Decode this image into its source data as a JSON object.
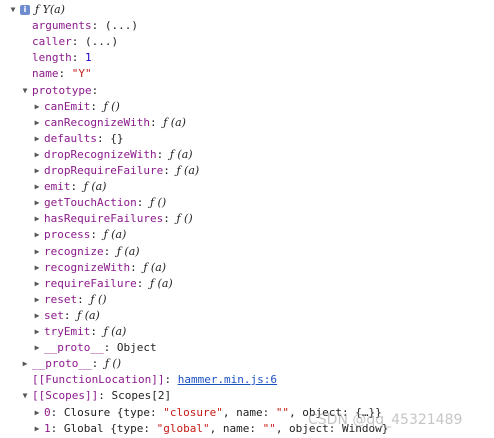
{
  "rows": [
    {
      "depth": 0,
      "arrow": "down",
      "badge": "i",
      "key": "",
      "sep": "",
      "value": "ƒ Y(a)",
      "vtype": "fn"
    },
    {
      "depth": 1,
      "arrow": "none",
      "key": "arguments",
      "sep": ": ",
      "value": "(...)",
      "vtype": "obj"
    },
    {
      "depth": 1,
      "arrow": "none",
      "key": "caller",
      "sep": ": ",
      "value": "(...)",
      "vtype": "obj"
    },
    {
      "depth": 1,
      "arrow": "none",
      "key": "length",
      "sep": ": ",
      "value": "1",
      "vtype": "num"
    },
    {
      "depth": 1,
      "arrow": "none",
      "key": "name",
      "sep": ": ",
      "value": "\"Y\"",
      "vtype": "str"
    },
    {
      "depth": 1,
      "arrow": "down",
      "key": "prototype",
      "sep": ":",
      "value": "",
      "vtype": "obj"
    },
    {
      "depth": 2,
      "arrow": "right",
      "key": "canEmit",
      "sep": ": ",
      "value": "ƒ ()",
      "vtype": "fn"
    },
    {
      "depth": 2,
      "arrow": "right",
      "key": "canRecognizeWith",
      "sep": ": ",
      "value": "ƒ (a)",
      "vtype": "fn"
    },
    {
      "depth": 2,
      "arrow": "right",
      "key": "defaults",
      "sep": ": ",
      "value": "{}",
      "vtype": "obj"
    },
    {
      "depth": 2,
      "arrow": "right",
      "key": "dropRecognizeWith",
      "sep": ": ",
      "value": "ƒ (a)",
      "vtype": "fn"
    },
    {
      "depth": 2,
      "arrow": "right",
      "key": "dropRequireFailure",
      "sep": ": ",
      "value": "ƒ (a)",
      "vtype": "fn"
    },
    {
      "depth": 2,
      "arrow": "right",
      "key": "emit",
      "sep": ": ",
      "value": "ƒ (a)",
      "vtype": "fn"
    },
    {
      "depth": 2,
      "arrow": "right",
      "key": "getTouchAction",
      "sep": ": ",
      "value": "ƒ ()",
      "vtype": "fn"
    },
    {
      "depth": 2,
      "arrow": "right",
      "key": "hasRequireFailures",
      "sep": ": ",
      "value": "ƒ ()",
      "vtype": "fn"
    },
    {
      "depth": 2,
      "arrow": "right",
      "key": "process",
      "sep": ": ",
      "value": "ƒ (a)",
      "vtype": "fn"
    },
    {
      "depth": 2,
      "arrow": "right",
      "key": "recognize",
      "sep": ": ",
      "value": "ƒ (a)",
      "vtype": "fn"
    },
    {
      "depth": 2,
      "arrow": "right",
      "key": "recognizeWith",
      "sep": ": ",
      "value": "ƒ (a)",
      "vtype": "fn"
    },
    {
      "depth": 2,
      "arrow": "right",
      "key": "requireFailure",
      "sep": ": ",
      "value": "ƒ (a)",
      "vtype": "fn"
    },
    {
      "depth": 2,
      "arrow": "right",
      "key": "reset",
      "sep": ": ",
      "value": "ƒ ()",
      "vtype": "fn"
    },
    {
      "depth": 2,
      "arrow": "right",
      "key": "set",
      "sep": ": ",
      "value": "ƒ (a)",
      "vtype": "fn"
    },
    {
      "depth": 2,
      "arrow": "right",
      "key": "tryEmit",
      "sep": ": ",
      "value": "ƒ (a)",
      "vtype": "fn"
    },
    {
      "depth": 2,
      "arrow": "right",
      "key": "__proto__",
      "sep": ": ",
      "value": "Object",
      "vtype": "obj"
    },
    {
      "depth": 1,
      "arrow": "right",
      "key": "__proto__",
      "sep": ": ",
      "value": "ƒ ()",
      "vtype": "fn"
    },
    {
      "depth": 1,
      "arrow": "none",
      "key": "[[FunctionLocation]]",
      "sep": ": ",
      "value": "hammer.min.js:6",
      "vtype": "link",
      "keyclass": "internal"
    },
    {
      "depth": 1,
      "arrow": "down",
      "key": "[[Scopes]]",
      "sep": ": ",
      "value": "Scopes[2]",
      "vtype": "obj",
      "keyclass": "internal"
    },
    {
      "depth": 2,
      "arrow": "right",
      "key": "0",
      "sep": ": ",
      "value": "Closure {type: \"closure\", name: \"\", object: {…}}",
      "vtype": "obj"
    },
    {
      "depth": 2,
      "arrow": "right",
      "key": "1",
      "sep": ": ",
      "value": "Global {type: \"global\", name: \"\", object: Window}",
      "vtype": "obj"
    }
  ],
  "watermark": "CSDN @qq_45321489",
  "colors": {
    "key": "#8b1a8b",
    "string": "#c41a16",
    "number": "#1c00cf",
    "link": "#1a4fc4",
    "arrow": "#555555"
  },
  "icons": {
    "down": "triangle-down-icon",
    "right": "triangle-right-icon",
    "badge": "info-icon"
  }
}
